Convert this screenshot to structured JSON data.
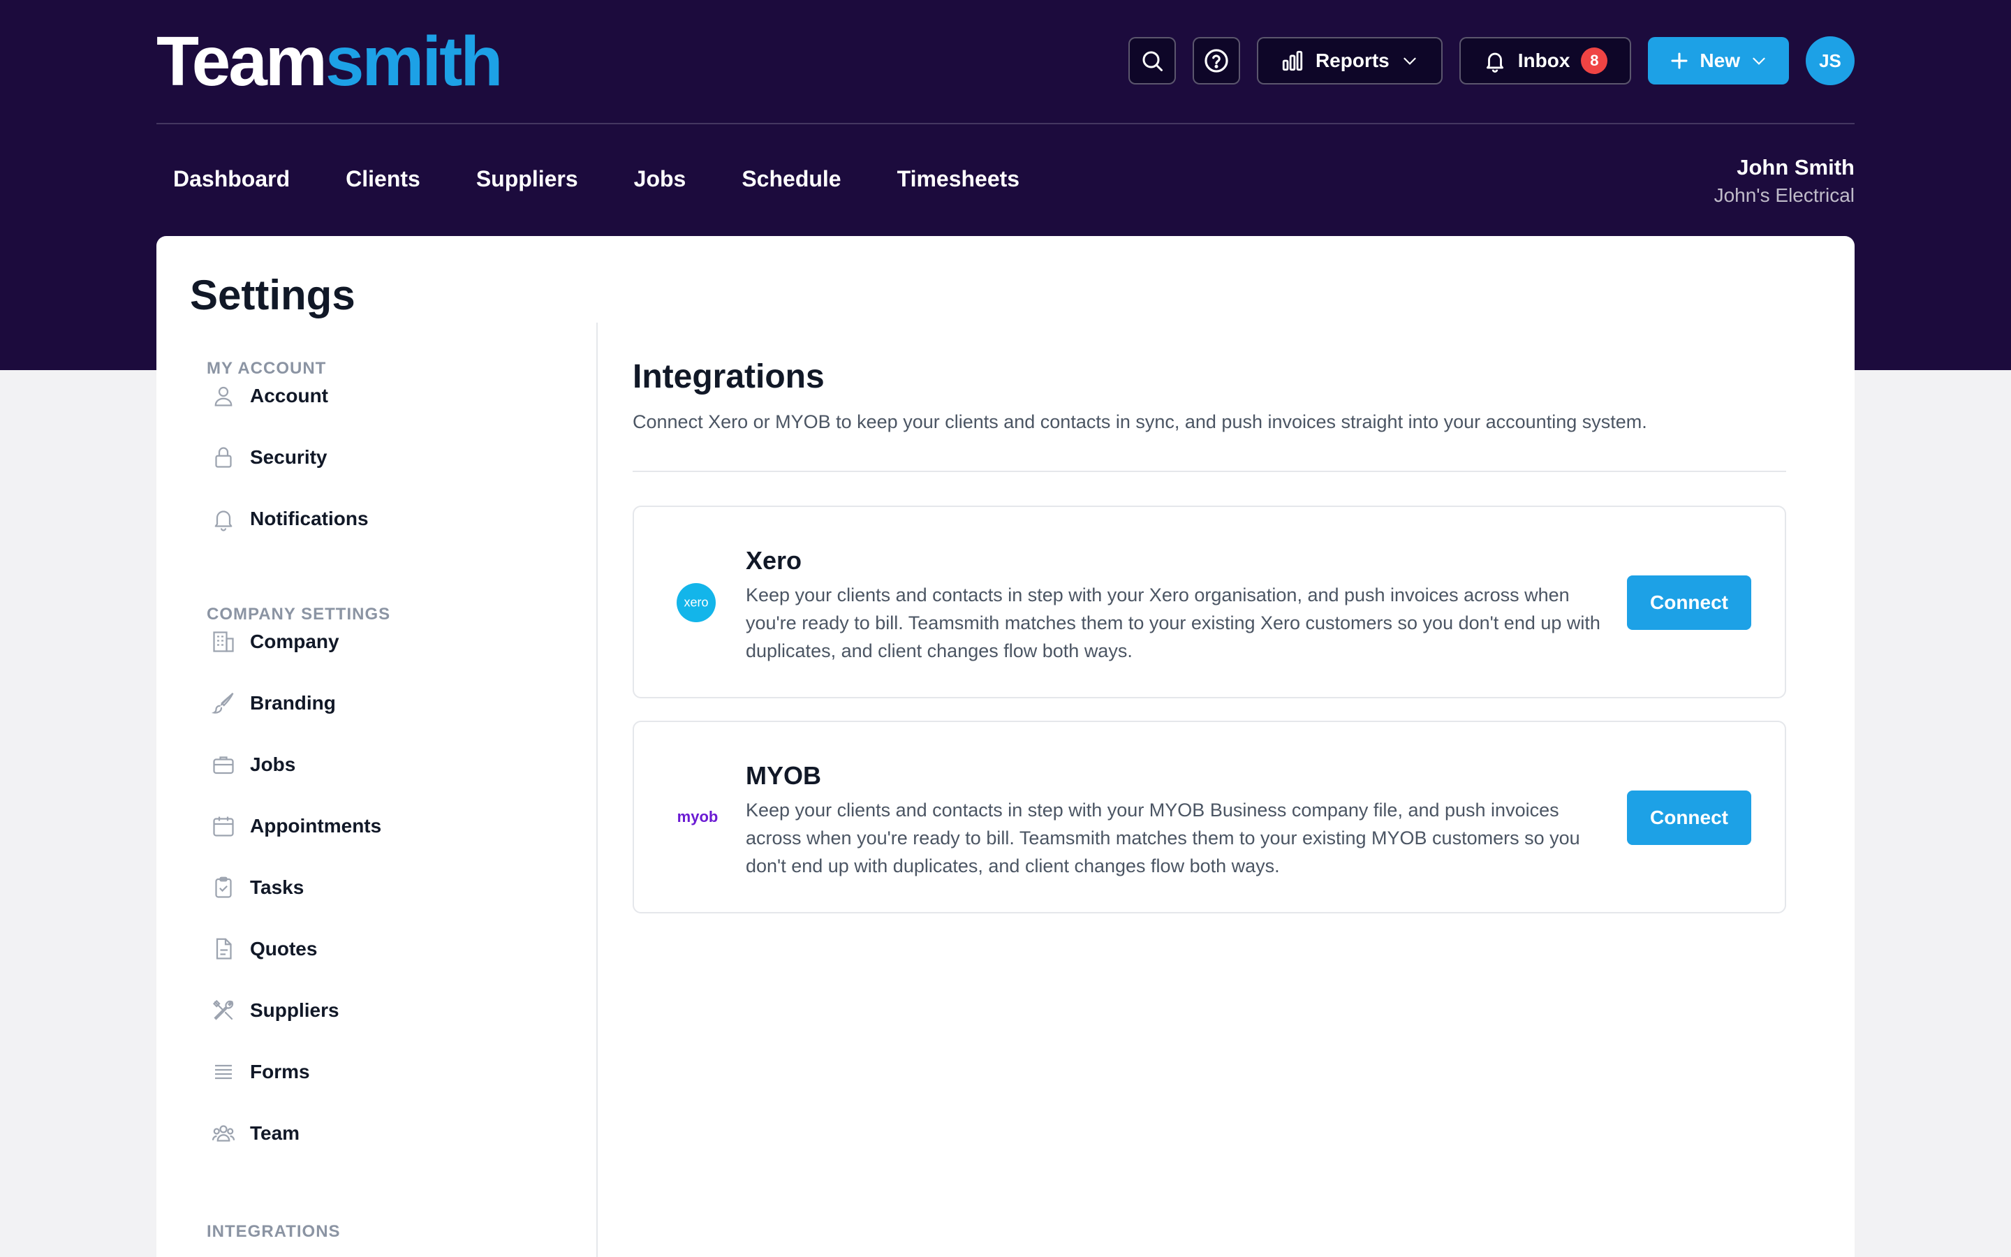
{
  "brand": {
    "name_part1": "Team",
    "name_part2": "smith",
    "accent_color": "#1da1e6",
    "header_bg": "#1c0b3d"
  },
  "header": {
    "search_icon": "search-icon",
    "help_icon": "help-icon",
    "reports_label": "Reports",
    "inbox_label": "Inbox",
    "inbox_count": "8",
    "new_label": "New",
    "avatar_initials": "JS"
  },
  "nav": {
    "items": [
      "Dashboard",
      "Clients",
      "Suppliers",
      "Jobs",
      "Schedule",
      "Timesheets"
    ]
  },
  "user": {
    "name": "John Smith",
    "company": "John's Electrical"
  },
  "page": {
    "title": "Settings"
  },
  "sidebar": {
    "sections": [
      {
        "heading": "MY ACCOUNT",
        "items": [
          {
            "label": "Account",
            "icon": "user-icon"
          },
          {
            "label": "Security",
            "icon": "lock-icon"
          },
          {
            "label": "Notifications",
            "icon": "bell-icon"
          }
        ]
      },
      {
        "heading": "COMPANY SETTINGS",
        "items": [
          {
            "label": "Company",
            "icon": "building-icon"
          },
          {
            "label": "Branding",
            "icon": "brush-icon"
          },
          {
            "label": "Jobs",
            "icon": "briefcase-icon"
          },
          {
            "label": "Appointments",
            "icon": "calendar-icon"
          },
          {
            "label": "Tasks",
            "icon": "clipboard-check-icon"
          },
          {
            "label": "Quotes",
            "icon": "document-icon"
          },
          {
            "label": "Suppliers",
            "icon": "tools-icon"
          },
          {
            "label": "Forms",
            "icon": "list-icon"
          },
          {
            "label": "Team",
            "icon": "users-icon"
          }
        ]
      },
      {
        "heading": "INTEGRATIONS",
        "items": []
      }
    ]
  },
  "integrations": {
    "title": "Integrations",
    "description": "Connect Xero or MYOB to keep your clients and contacts in sync, and push invoices straight into your accounting system.",
    "cards": [
      {
        "name": "Xero",
        "logo_text": "xero",
        "logo_color": "#13b5ea",
        "description": "Keep your clients and contacts in step with your Xero organisation, and push invoices across when you're ready to bill. Teamsmith matches them to your existing Xero customers so you don't end up with duplicates, and client changes flow both ways.",
        "button": "Connect"
      },
      {
        "name": "MYOB",
        "logo_text": "myob",
        "logo_color": "#6b1bd3",
        "description": "Keep your clients and contacts in step with your MYOB Business company file, and push invoices across when you're ready to bill. Teamsmith matches them to your existing MYOB customers so you don't end up with duplicates, and client changes flow both ways.",
        "button": "Connect"
      }
    ]
  }
}
